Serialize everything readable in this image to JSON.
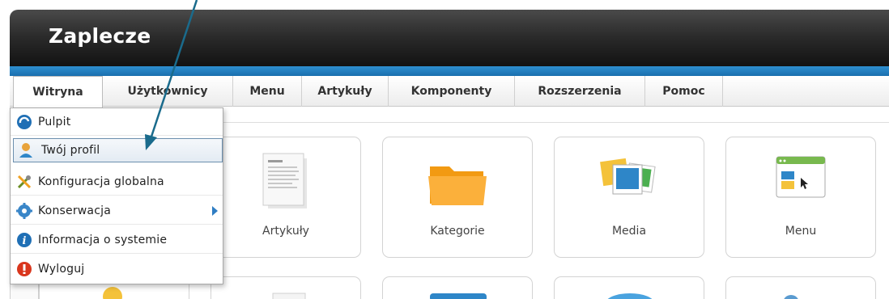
{
  "header": {
    "title": "Zaplecze"
  },
  "menubar": {
    "items": [
      {
        "label": "Witryna"
      },
      {
        "label": "Użytkownicy"
      },
      {
        "label": "Menu"
      },
      {
        "label": "Artykuły"
      },
      {
        "label": "Komponenty"
      },
      {
        "label": "Rozszerzenia"
      },
      {
        "label": "Pomoc"
      }
    ],
    "active": "Witryna"
  },
  "dropdown": {
    "items": [
      {
        "label": "Pulpit",
        "icon": "dashboard-icon"
      },
      {
        "label": "Twój profil",
        "icon": "user-profile-icon"
      },
      {
        "label": "Konfiguracja globalna",
        "icon": "tools-icon"
      },
      {
        "label": "Konserwacja",
        "icon": "gear-icon",
        "has_submenu": true
      },
      {
        "label": "Informacja o systemie",
        "icon": "info-icon"
      },
      {
        "label": "Wyloguj",
        "icon": "logout-icon"
      }
    ],
    "highlighted": "Twój profil"
  },
  "cards": [
    {
      "label": "Artykuły",
      "icon": "article-icon"
    },
    {
      "label": "Kategorie",
      "icon": "folder-icon"
    },
    {
      "label": "Media",
      "icon": "media-icon"
    },
    {
      "label": "Menu",
      "icon": "menu-window-icon"
    }
  ],
  "colors": {
    "header_dark": "#1e1e1e",
    "accent_blue": "#1a6fae",
    "annotation_arrow": "#1a6b8c",
    "folder_orange": "#f7a21b"
  }
}
